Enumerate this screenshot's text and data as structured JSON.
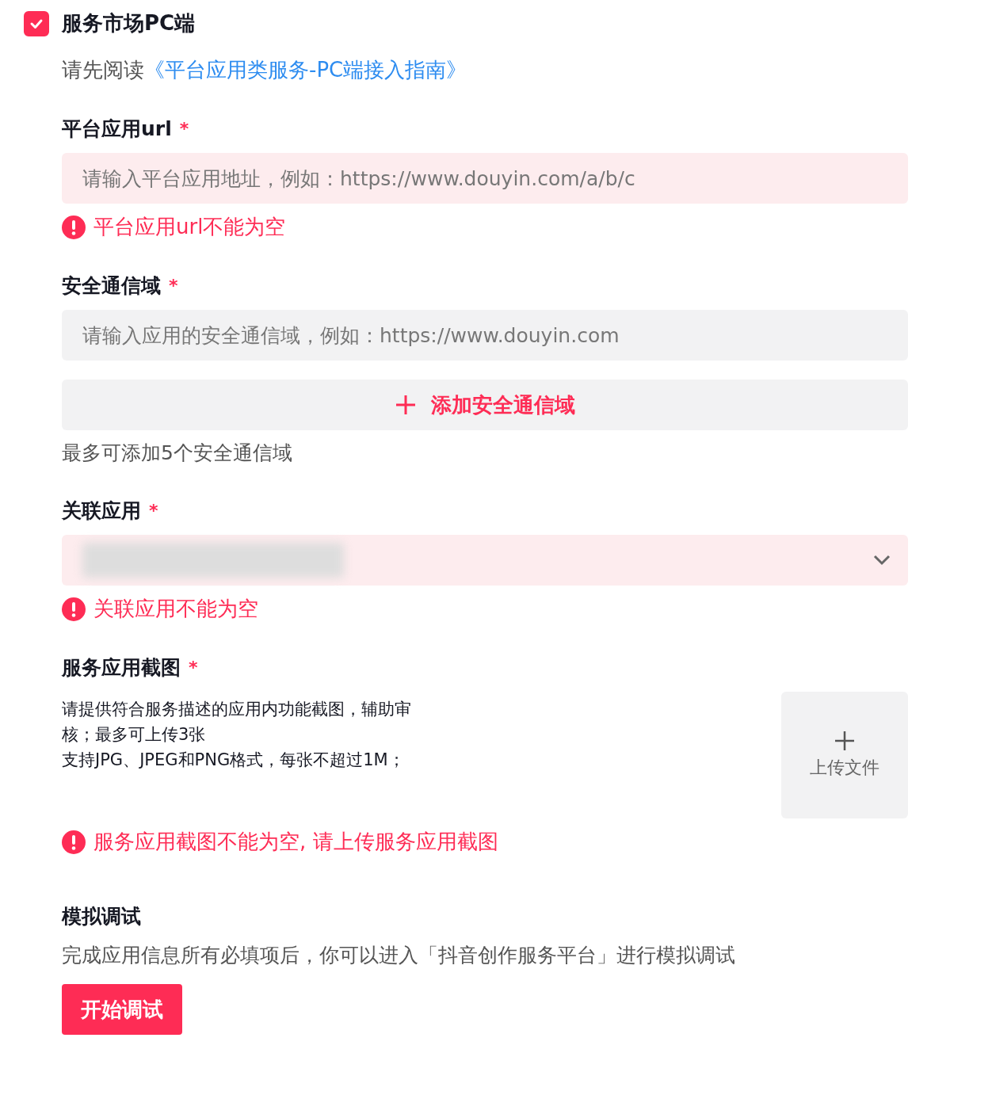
{
  "section": {
    "title": "服务市场PC端",
    "checked": true
  },
  "guide": {
    "prefix": "请先阅读",
    "link": "《平台应用类服务-PC端接入指南》"
  },
  "fields": [
    {
      "kind": "input",
      "label": "平台应用url",
      "required_mark": "*",
      "placeholder": "请输入平台应用地址，例如：https://www.douyin.com/a/b/c",
      "error": "平台应用url不能为空"
    },
    {
      "kind": "input",
      "label": "安全通信域",
      "required_mark": "*",
      "placeholder": "请输入应用的安全通信域，例如：https://www.douyin.com",
      "add_button": "添加安全通信域",
      "hint": "最多可添加5个安全通信域"
    },
    {
      "kind": "select",
      "label": "关联应用",
      "required_mark": "*",
      "redacted": true,
      "error": "关联应用不能为空"
    },
    {
      "kind": "upload",
      "label": "服务应用截图",
      "required_mark": "*",
      "description": [
        "请提供符合服务描述的应用内功能截图，辅助审核；最多可上传3张",
        "支持JPG、JPEG和PNG格式，每张不超过1M；"
      ],
      "upload_label": "上传文件",
      "error": "服务应用截图不能为空, 请上传服务应用截图"
    }
  ],
  "debug": {
    "title": "模拟调试",
    "text": "完成应用信息所有必填项后，你可以进入「抖音创作服务平台」进行模拟调试",
    "button": "开始调试"
  }
}
